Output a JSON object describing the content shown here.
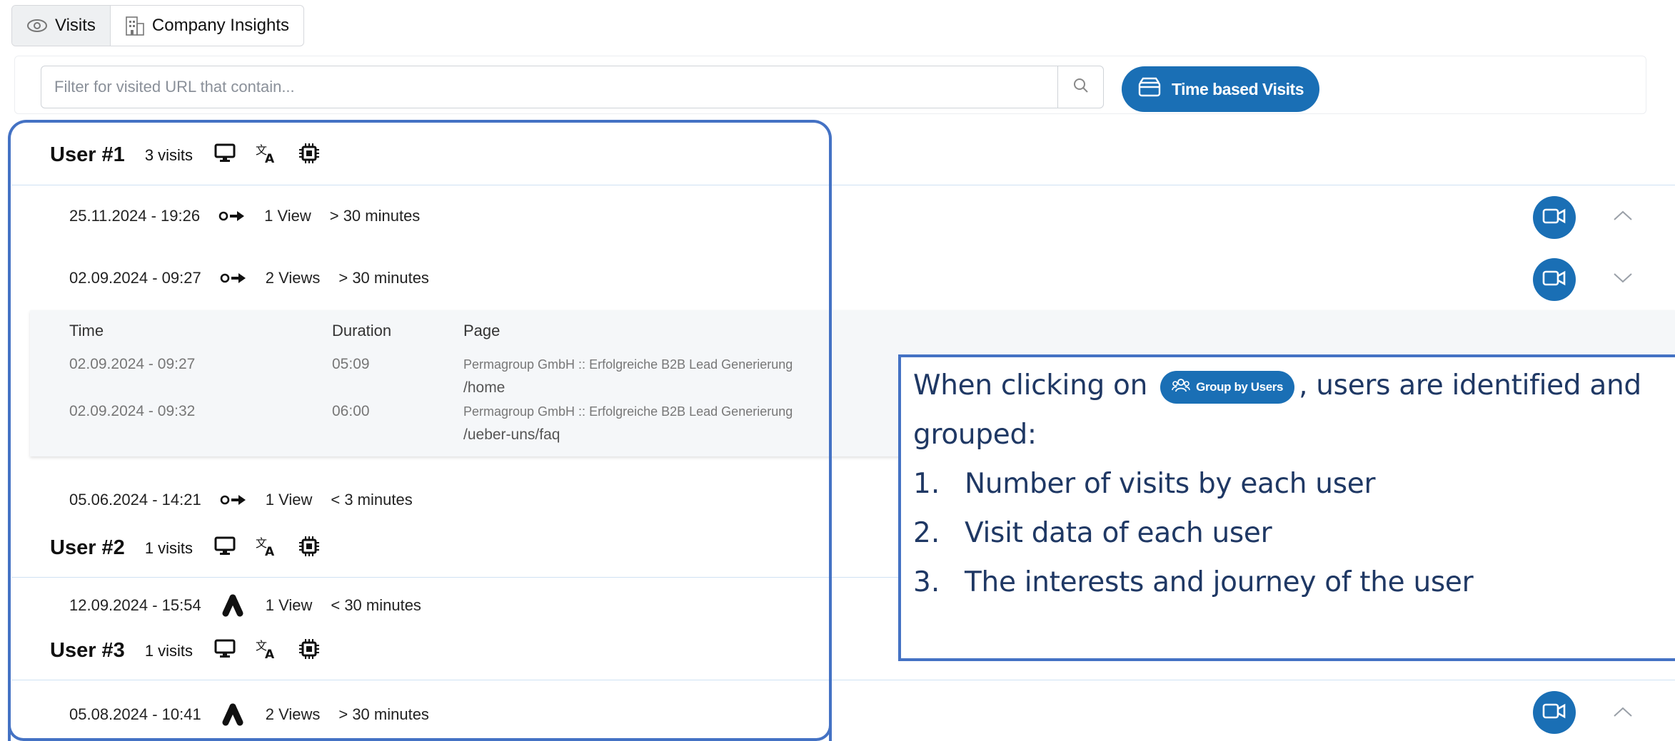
{
  "tabs": [
    {
      "label": "Visits",
      "icon": "eye-icon",
      "active": true
    },
    {
      "label": "Company Insights",
      "icon": "building-icon",
      "active": false
    }
  ],
  "filter": {
    "placeholder": "Filter for visited URL that contain...",
    "time_button": "Time based Visits"
  },
  "users": [
    {
      "title": "User #1",
      "visits": "3 visits",
      "sessions": [
        {
          "date": "25.11.2024 - 19:26",
          "source": "direct",
          "views": "1 View",
          "duration": "> 30 minutes",
          "expanded": false
        },
        {
          "date": "02.09.2024 - 09:27",
          "source": "direct",
          "views": "2 Views",
          "duration": "> 30 minutes",
          "expanded": true
        },
        {
          "date": "05.06.2024 - 14:21",
          "source": "direct",
          "views": "1 View",
          "duration": "< 3 minutes",
          "expanded": false
        }
      ]
    },
    {
      "title": "User #2",
      "visits": "1 visits",
      "sessions": [
        {
          "date": "12.09.2024 - 15:54",
          "source": "ads",
          "views": "1 View",
          "duration": "< 30 minutes",
          "expanded": false
        }
      ]
    },
    {
      "title": "User #3",
      "visits": "1 visits",
      "sessions": [
        {
          "date": "05.08.2024 - 10:41",
          "source": "ads",
          "views": "2 Views",
          "duration": "> 30 minutes",
          "expanded": false
        }
      ]
    }
  ],
  "detail": {
    "headers": {
      "time": "Time",
      "duration": "Duration",
      "page": "Page"
    },
    "rows": [
      {
        "time": "02.09.2024 - 09:27",
        "duration": "05:09",
        "title": "Permagroup GmbH :: Erfolgreiche B2B Lead Generierung",
        "path": "/home"
      },
      {
        "time": "02.09.2024 - 09:32",
        "duration": "06:00",
        "title": "Permagroup GmbH :: Erfolgreiche B2B Lead Generierung",
        "path": "/ueber-uns/faq"
      }
    ]
  },
  "callout": {
    "line1_before": "When clicking on",
    "pill_label": "Group by Users",
    "line1_after": ", users are identified and",
    "line2": "grouped:",
    "items": [
      "Number of visits by each user",
      "Visit data of each user",
      "The interests and journey of the user"
    ],
    "numbers": [
      "1.",
      "2.",
      "3."
    ]
  },
  "colors": {
    "accent": "#1a6fb5",
    "annotation": "#4472c4",
    "annotation_text": "#1f3864"
  }
}
